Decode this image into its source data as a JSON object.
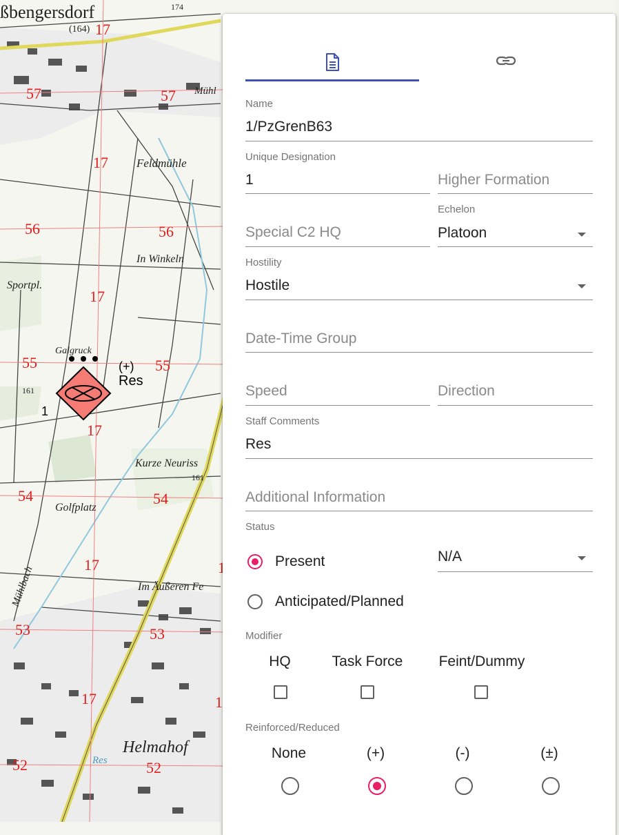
{
  "map": {
    "town_top": "ßbengersdorf",
    "elev_top": "(164)",
    "spot_174": "174",
    "feldmuhle": "Feldmühle",
    "in_winkeln": "In Winkeln",
    "sportpl": "Sportpl.",
    "galgruck": "Galgruck",
    "kurze": "Kurze Neuriss",
    "golfplatz": "Golfplatz",
    "mublbach": "Mühlbach",
    "aussere": "Im Äußeren Fe",
    "helmahof": "Helmahof",
    "res_water": "Res",
    "muhl": "Mühl",
    "spot_161a": "161",
    "spot_161b": "161",
    "grid": {
      "n57": "57",
      "n56": "56",
      "n55": "55",
      "n54": "54",
      "n53": "53",
      "n52": "52",
      "e17": "17",
      "e1": "1"
    },
    "unit_symbol": {
      "echelon_dots": "•••",
      "reinforced": "(+)",
      "comment": "Res",
      "designation": "1",
      "color": "#f47c74"
    }
  },
  "tabs": [
    {
      "name": "details",
      "icon": "document-icon",
      "active": true
    },
    {
      "name": "links",
      "icon": "link-icon",
      "active": false
    }
  ],
  "form": {
    "name": {
      "label": "Name",
      "value": "1/PzGrenB63"
    },
    "unique_designation": {
      "label": "Unique Designation",
      "value": "1"
    },
    "higher_formation": {
      "placeholder": "Higher Formation"
    },
    "special_c2_hq": {
      "placeholder": "Special C2 HQ"
    },
    "echelon": {
      "label": "Echelon",
      "value": "Platoon"
    },
    "hostility": {
      "label": "Hostility",
      "value": "Hostile"
    },
    "date_time_group": {
      "placeholder": "Date-Time Group"
    },
    "speed": {
      "placeholder": "Speed"
    },
    "direction": {
      "placeholder": "Direction"
    },
    "staff_comments": {
      "label": "Staff Comments",
      "value": "Res"
    },
    "additional_information": {
      "placeholder": "Additional Information"
    },
    "status": {
      "label": "Status",
      "options": [
        "Present",
        "Anticipated/Planned"
      ],
      "selected": "Present",
      "condition_value": "N/A"
    },
    "modifier": {
      "label": "Modifier",
      "options": [
        "HQ",
        "Task Force",
        "Feint/Dummy"
      ]
    },
    "reinforced_reduced": {
      "label": "Reinforced/Reduced",
      "options": [
        "None",
        "(+)",
        "(-)",
        "(±)"
      ],
      "selected": "(+)"
    }
  },
  "colors": {
    "accent_primary": "#3f51b5",
    "accent_secondary": "#e91e63",
    "hostile_fill": "#f47c74",
    "grid_line": "#f08080",
    "grid_number": "#e0201f"
  }
}
